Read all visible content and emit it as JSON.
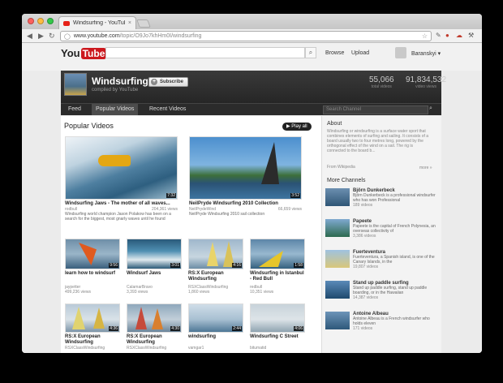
{
  "browser": {
    "tab_title": "Windsurfing - YouTube",
    "url_prefix": "www.youtube.com",
    "url_path": "/topic/O9Jo7khHm0I/windsurfing",
    "tab_close": "×"
  },
  "header": {
    "logo_you": "You",
    "logo_tube": "Tube",
    "browse": "Browse",
    "upload": "Upload",
    "user": "Baranskyi ▾"
  },
  "channel": {
    "name": "Windsurfing",
    "subtitle": "compiled by YouTube",
    "subscribe": "Subscribe",
    "total_videos": "55,066",
    "total_videos_label": "total videos",
    "video_views": "91,834,532",
    "video_views_label": "video views",
    "tabs": [
      "Feed",
      "Popular Videos",
      "Recent Videos"
    ],
    "search_placeholder": "Search Channel"
  },
  "main": {
    "title": "Popular Videos",
    "play_all": "▶ Play all",
    "featured": [
      {
        "title": "Windsurfing Jaws - The mother of all waves...",
        "channel": "rodbull",
        "views": "204,361 views",
        "duration": "7:32",
        "desc": "Windsurfing world champion Jason Polakow has been on a search for the biggest, most gnarly waves until he found"
      },
      {
        "title": "NeilPryde Windsurfing 2010 Collection",
        "channel": "NeilPrydeWind",
        "views": "66,659 views",
        "duration": "3:52",
        "desc": "NeilPryde Windsurfing 2010 sail collection"
      }
    ],
    "grid_row1": [
      {
        "title": "learn how to windsurf",
        "channel": "jaypetter",
        "views": "499,236 views",
        "duration": "9:56"
      },
      {
        "title": "Windsurf Jaws",
        "channel": "CalamarBravo",
        "views": "3,393 views",
        "duration": "3:01"
      },
      {
        "title": "RS:X European Windsurfing",
        "channel": "RSXClassWindsurfing",
        "views": "1,860 views",
        "duration": "4:16"
      },
      {
        "title": "Windsurfing in Istanbul - Red Bull",
        "channel": "redbull",
        "views": "10,351 views",
        "duration": "1:58"
      }
    ],
    "grid_row2": [
      {
        "title": "RS:X European Windsurfing",
        "channel": "RSXClassWindsurfing",
        "views": "",
        "duration": "4:36"
      },
      {
        "title": "RS:X European Windsurfing",
        "channel": "RSXClassWindsurfing",
        "views": "",
        "duration": "4:30"
      },
      {
        "title": "windsurfing",
        "channel": "vamgar1",
        "views": "",
        "duration": "2:44"
      },
      {
        "title": "Windsurfing C Street",
        "channel": "bitumatid",
        "views": "",
        "duration": "4:06"
      }
    ]
  },
  "sidebar": {
    "about_title": "About",
    "about_text": "Windsurfing or windsurfing is a surface water sport that combines elements of surfing and sailing. It consists of a board usually two to four metres long, powered by the orthogonal effect of the wind on a sail. The rig is connected to the board b...",
    "wiki": "From Wikipedia",
    "more_link": "more »",
    "more_channels_title": "More Channels",
    "channels": [
      {
        "name": "Björn Dunkerbeck",
        "desc": "Björn Dunkerbeck is a professional windsurfer who has won Professional",
        "count": "189 videos"
      },
      {
        "name": "Papeete",
        "desc": "Papeete is the capital of French Polynesia, an overseas collectivity of",
        "count": "3,386 videos"
      },
      {
        "name": "Fuerteventura",
        "desc": "Fuerteventura, a Spanish island, is one of the Canary Islands, in the",
        "count": "19,807 videos"
      },
      {
        "name": "Stand up paddle surfing",
        "desc": "Stand up paddle surfing, stand up paddle boarding, or in the Hawaiian",
        "count": "14,387 videos"
      },
      {
        "name": "Antoine Albeau",
        "desc": "Antoine Albeau is a French windsurfer who holds eleven",
        "count": "171 videos"
      }
    ]
  },
  "colors": {
    "brand_red": "#cc181e",
    "banner_dark": "#2b2b2b"
  }
}
